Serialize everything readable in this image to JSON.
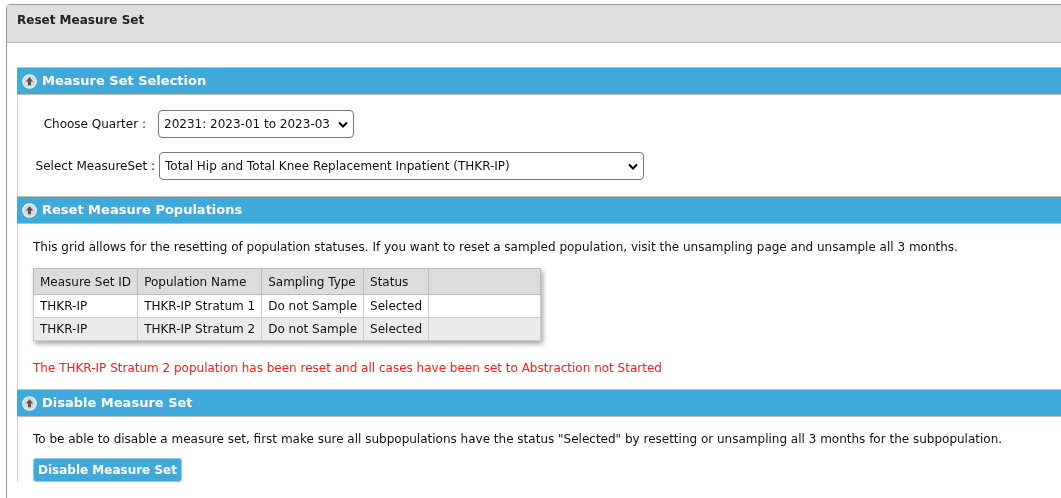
{
  "window": {
    "title": "Reset Measure Set"
  },
  "selection": {
    "title": "Measure Set Selection",
    "quarter": {
      "label": "Choose Quarter :",
      "value": "20231: 2023-01 to 2023-03"
    },
    "measure_set": {
      "label": "Select MeasureSet :",
      "value": "Total Hip and Total Knee Replacement Inpatient (THKR-IP)"
    }
  },
  "populations": {
    "title": "Reset Measure Populations",
    "description": "This grid allows for the resetting of population statuses. If you want to reset a sampled population, visit the unsampling page and unsample all 3 months.",
    "table": {
      "columns": [
        "Measure Set ID",
        "Population Name",
        "Sampling Type",
        "Status"
      ],
      "rows": [
        [
          "THKR-IP",
          "THKR-IP Stratum 1",
          "Do not Sample",
          "Selected"
        ],
        [
          "THKR-IP",
          "THKR-IP Stratum 2",
          "Do not Sample",
          "Selected"
        ]
      ]
    },
    "message": "The THKR-IP Stratum 2 population has been reset and all cases have been set to Abstraction not Started"
  },
  "disable": {
    "title": "Disable Measure Set",
    "description": "To be able to disable a measure set, first make sure all subpopulations have the status \"Selected\" by resetting or unsampling all 3 months for the subpopulation.",
    "button": "Disable Measure Set"
  }
}
